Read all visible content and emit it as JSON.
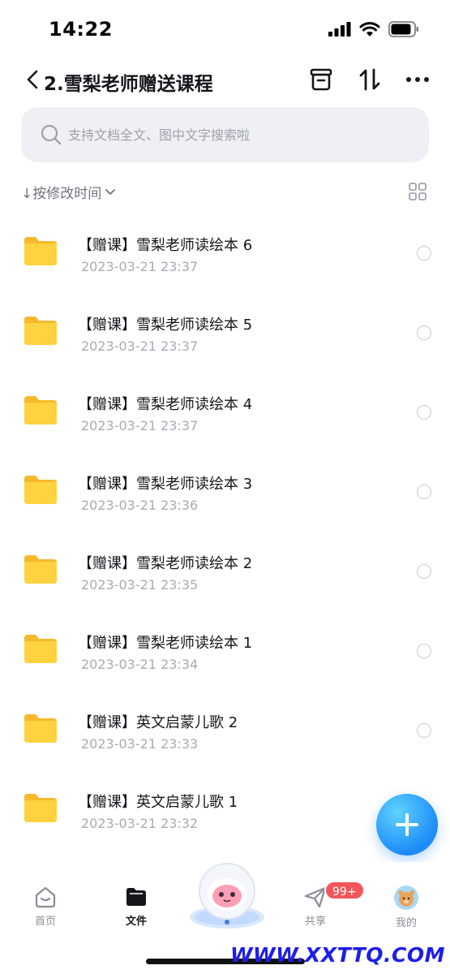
{
  "status": {
    "time": "14:22"
  },
  "nav": {
    "title": "2.雪梨老师赠送课程"
  },
  "search": {
    "placeholder": "支持文档全文、图中文字搜索啦"
  },
  "sort": {
    "label": "↓按修改时间"
  },
  "files": [
    {
      "name": "【赠课】雪梨老师读绘本 6",
      "date": "2023-03-21 23:37"
    },
    {
      "name": "【赠课】雪梨老师读绘本 5",
      "date": "2023-03-21 23:37"
    },
    {
      "name": "【赠课】雪梨老师读绘本 4",
      "date": "2023-03-21 23:37"
    },
    {
      "name": "【赠课】雪梨老师读绘本 3",
      "date": "2023-03-21 23:36"
    },
    {
      "name": "【赠课】雪梨老师读绘本 2",
      "date": "2023-03-21 23:35"
    },
    {
      "name": "【赠课】雪梨老师读绘本 1",
      "date": "2023-03-21 23:34"
    },
    {
      "name": "【赠课】英文启蒙儿歌 2",
      "date": "2023-03-21 23:33"
    },
    {
      "name": "【赠课】英文启蒙儿歌 1",
      "date": "2023-03-21 23:32"
    }
  ],
  "tabs": {
    "home": "首页",
    "files": "文件",
    "share": "共享",
    "me": "我的"
  },
  "share_badge": "99+",
  "watermark": "WWW.XXTTQ.COM",
  "colors": {
    "accent": "#1d8cf8",
    "folder": "#ffcc33",
    "badge": "#f2555a"
  }
}
